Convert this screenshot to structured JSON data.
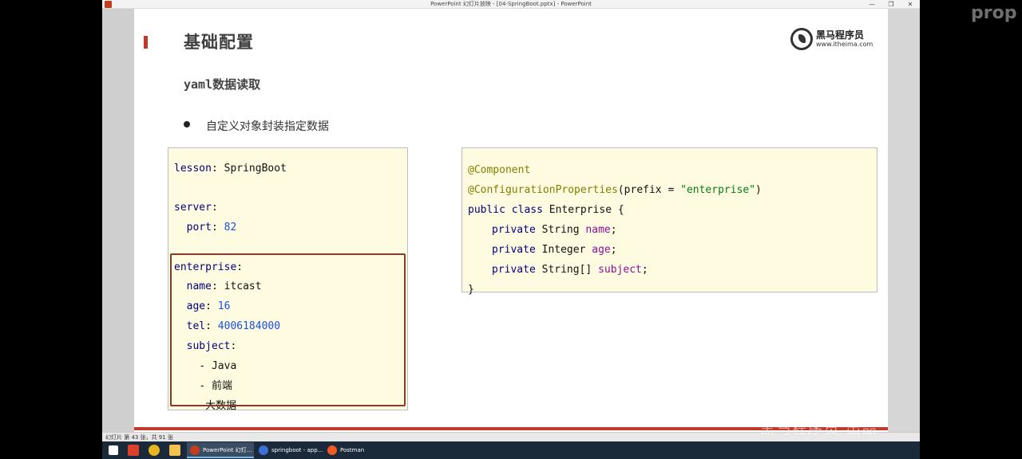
{
  "window": {
    "title": "PowerPoint 幻灯片放映 - [04-SpringBoot.pptx] - PowerPoint",
    "controls": {
      "minimize": "—",
      "restore": "❐",
      "close": "✕"
    }
  },
  "slide": {
    "title": "基础配置",
    "subtitle": "yaml数据读取",
    "bullet": "自定义对象封装指定数据",
    "logo": {
      "brand": "黑马程序员",
      "url": "www.itheima.com"
    }
  },
  "yaml_code": {
    "lines": [
      {
        "key": "lesson",
        "sep": ": ",
        "val": "SpringBoot",
        "indent": ""
      },
      {
        "key": "server",
        "sep": ":",
        "val": "",
        "indent": ""
      },
      {
        "key": "port",
        "sep": ": ",
        "val": "82",
        "indent": "  "
      },
      {
        "key": "enterprise",
        "sep": ":",
        "val": "",
        "indent": ""
      },
      {
        "key": "name",
        "sep": ": ",
        "val": "itcast",
        "indent": "  "
      },
      {
        "key": "age",
        "sep": ": ",
        "val": "16",
        "indent": "  "
      },
      {
        "key": "tel",
        "sep": ": ",
        "val": "4006184000",
        "indent": "  "
      },
      {
        "key": "subject",
        "sep": ":",
        "val": "",
        "indent": "  "
      },
      {
        "key": "",
        "sep": "- ",
        "val": "Java",
        "indent": "    "
      },
      {
        "key": "",
        "sep": "- ",
        "val": "前端",
        "indent": "    "
      },
      {
        "key": "",
        "sep": "- ",
        "val": "大数据",
        "indent": "   "
      }
    ]
  },
  "java_code": {
    "annotation1": "@Component",
    "annotation2": "@ConfigurationProperties",
    "annotation2_args_open": "(prefix = ",
    "annotation2_string": "\"enterprise\"",
    "annotation2_args_close": ")",
    "class_kw": "public class",
    "class_name": " Enterprise {",
    "fields": [
      {
        "kw": "private",
        "type": " String ",
        "name": "name",
        "end": ";"
      },
      {
        "kw": "private",
        "type": " Integer ",
        "name": "age",
        "end": ";"
      },
      {
        "kw": "private",
        "type": " String[] ",
        "name": "subject",
        "end": ";"
      }
    ],
    "close": "}"
  },
  "statusbar": {
    "text": "幻灯片 第 43 张，共 91 张"
  },
  "taskbar": {
    "tasks": [
      {
        "label": "PowerPoint 幻灯...",
        "color": "#c43e1c"
      },
      {
        "label": "springboot - app...",
        "color": "#3d6fd8"
      },
      {
        "label": "Postman",
        "color": "#ef5b25"
      }
    ]
  },
  "watermark": {
    "top": "prop",
    "bottom": "黑马程序员 出品"
  },
  "colors": {
    "accent": "#c0392b",
    "code_bg": "#fffbe0",
    "frame": "#8b3a2a"
  }
}
